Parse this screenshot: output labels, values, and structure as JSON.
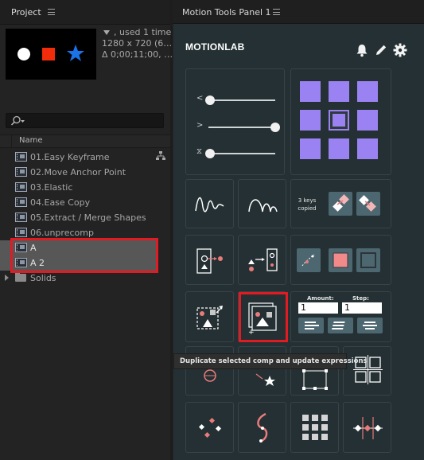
{
  "project_panel": {
    "tab_title": "Project",
    "info": {
      "line1": ", used 1 time",
      "line2": "1280 x 720  (6…",
      "line3": "Δ 0;00;11;00, …"
    },
    "column_name": "Name",
    "items": [
      {
        "label": "01.Easy Keyframe",
        "type": "comp"
      },
      {
        "label": "02.Move Anchor Point",
        "type": "comp"
      },
      {
        "label": "03.Elastic",
        "type": "comp"
      },
      {
        "label": "04.Ease Copy",
        "type": "comp"
      },
      {
        "label": "05.Extract / Merge Shapes",
        "type": "comp"
      },
      {
        "label": "06.unprecomp",
        "type": "comp"
      },
      {
        "label": "A",
        "type": "comp",
        "selected": true
      },
      {
        "label": "A 2",
        "type": "comp",
        "selected": true
      },
      {
        "label": "Solids",
        "type": "folder"
      }
    ],
    "highlight_color": "#e11b22"
  },
  "motion_panel": {
    "tab_title": "Motion Tools Panel 1",
    "brand": "MOTIONLAB",
    "header_icons": [
      "bell-icon",
      "pencil-icon",
      "gear-icon"
    ],
    "sliders": [
      {
        "glyph": "<",
        "value": 0.05
      },
      {
        "glyph": ">",
        "value": 1.0
      },
      {
        "glyph": "⧖",
        "value": 0.05
      }
    ],
    "keys_copied": {
      "line1": "3 keys",
      "line2": "copied"
    },
    "amount_label": "Amount:",
    "step_label": "Step:",
    "amount_value": "1",
    "step_value": "1",
    "tooltip": "Duplicate selected comp and update expressions",
    "accent": "#9b82f2",
    "tile_bg": "#243033",
    "button_bg": "#4d6771"
  }
}
